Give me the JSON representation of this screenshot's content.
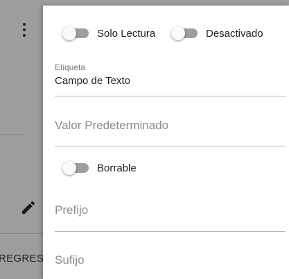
{
  "background": {
    "back_button_label": "REGRESAR",
    "menu_icon": "more-vert-icon",
    "edit_icon": "pencil-icon"
  },
  "drawer": {
    "toggles": {
      "read_only": {
        "label": "Solo Lectura",
        "on": false
      },
      "disabled": {
        "label": "Desactivado",
        "on": false
      },
      "clearable": {
        "label": "Borrable",
        "on": false
      }
    },
    "fields": {
      "label": {
        "floating_label": "Etiqueta",
        "value": "Campo de Texto"
      },
      "default_value": {
        "placeholder": "Valor Predeterminado"
      },
      "prefix": {
        "placeholder": "Prefijo"
      },
      "suffix": {
        "placeholder": "Sufijo"
      }
    }
  }
}
